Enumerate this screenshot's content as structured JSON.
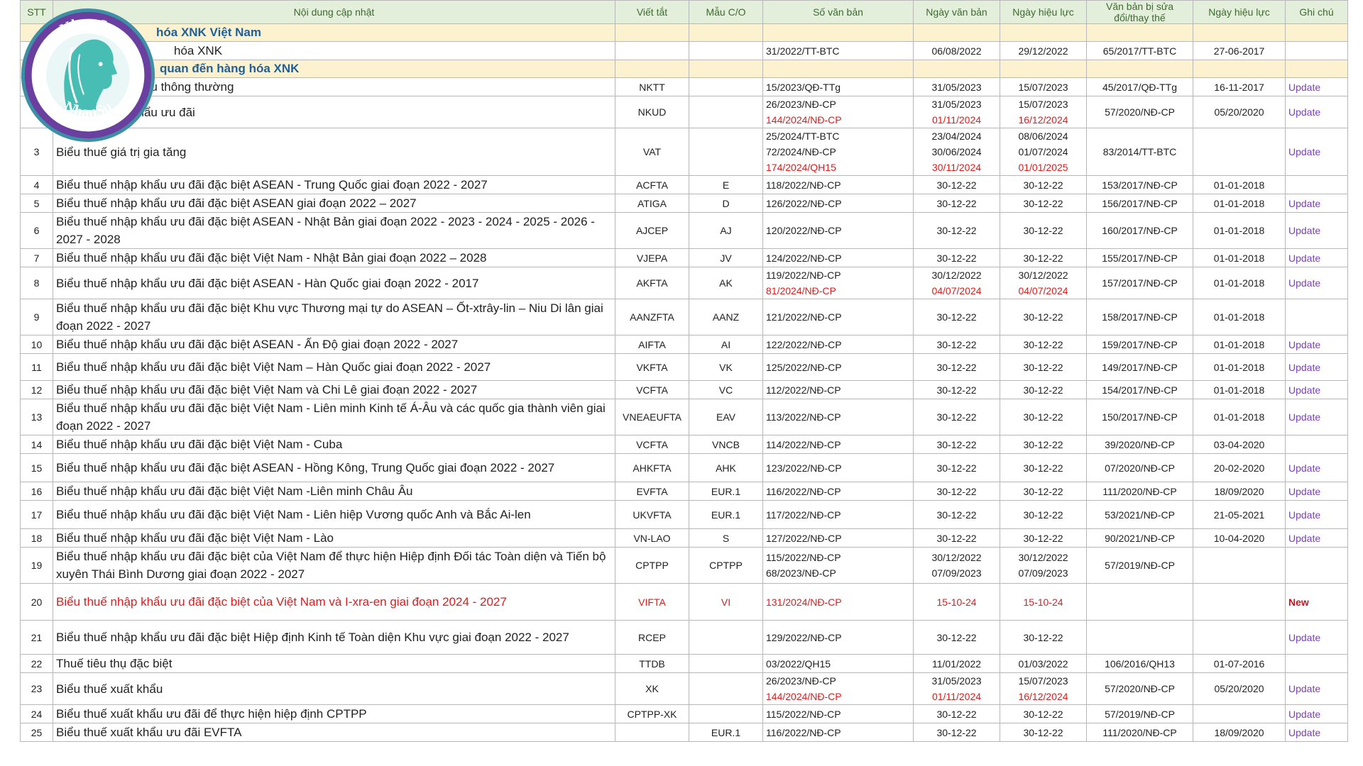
{
  "table": {
    "headers": [
      "STT",
      "Nội dung cập nhật",
      "Viết tắt",
      "Mẫu C/O",
      "Số văn bản",
      "Ngày văn bản",
      "Ngày hiệu lực",
      "Văn bản bị sửa đổi/thay thế",
      "Ngày hiệu lực",
      "Ghi chú"
    ],
    "sections": [
      {
        "title": "hóa XNK Việt Nam"
      },
      {
        "content": "hóa XNK",
        "sovanban": "31/2022/TT-BTC",
        "ngayvb": "06/08/2022",
        "ngayhl": "29/12/2022",
        "vbthaythe": "65/2017/TT-BTC",
        "ngayhl2": "27-06-2017"
      },
      {
        "title": "quan đến hàng hóa XNK"
      }
    ],
    "rows": [
      {
        "stt": "",
        "content": "khẩu thông thường",
        "viettat": "NKTT",
        "mauco": "",
        "sovanban": [
          {
            "t": "15/2023/QĐ-TTg"
          }
        ],
        "ngayvb": [
          {
            "t": "31/05/2023"
          }
        ],
        "ngayhl": [
          {
            "t": "15/07/2023"
          }
        ],
        "vbthaythe": "45/2017/QĐ-TTg",
        "ngayhl2": "16-11-2017",
        "note": "Update",
        "h": 24
      },
      {
        "stt": "",
        "content": "khẩu ưu đãi",
        "viettat": "NKUD",
        "mauco": "",
        "sovanban": [
          {
            "t": "26/2023/NĐ-CP"
          },
          {
            "t": "144/2024/NĐ-CP",
            "red": true
          }
        ],
        "ngayvb": [
          {
            "t": "31/05/2023"
          },
          {
            "t": "01/11/2024",
            "red": true
          }
        ],
        "ngayhl": [
          {
            "t": "15/07/2023"
          },
          {
            "t": "16/12/2024",
            "red": true
          }
        ],
        "vbthaythe": "57/2020/NĐ-CP",
        "ngayhl2": "05/20/2020",
        "note": "Update",
        "h": 40
      },
      {
        "stt": "3",
        "content": "Biểu thuế giá trị gia tăng",
        "viettat": "VAT",
        "mauco": "",
        "sovanban": [
          {
            "t": "25/2024/TT-BTC"
          },
          {
            "t": "72/2024/NĐ-CP"
          },
          {
            "t": "174/2024/QH15",
            "red": true
          }
        ],
        "ngayvb": [
          {
            "t": "23/04/2024"
          },
          {
            "t": "30/06/2024"
          },
          {
            "t": "30/11/2024",
            "red": true
          }
        ],
        "ngayhl": [
          {
            "t": "08/06/2024"
          },
          {
            "t": "01/07/2024"
          },
          {
            "t": "01/01/2025",
            "red": true
          }
        ],
        "vbthaythe": "83/2014/TT-BTC",
        "ngayhl2": "",
        "note": "Update",
        "h": 62
      },
      {
        "stt": "4",
        "content": "Biểu thuế nhập khẩu ưu đãi đặc biệt ASEAN - Trung Quốc giai đoạn 2022 - 2027",
        "viettat": "ACFTA",
        "mauco": "E",
        "sovanban": [
          {
            "t": "118/2022/NĐ-CP"
          }
        ],
        "ngayvb": [
          {
            "t": "30-12-22"
          }
        ],
        "ngayhl": [
          {
            "t": "30-12-22"
          }
        ],
        "vbthaythe": "153/2017/NĐ-CP",
        "ngayhl2": "01-01-2018",
        "note": "",
        "h": 22
      },
      {
        "stt": "5",
        "content": "Biểu thuế nhập khẩu ưu đãi đặc biệt ASEAN giai đoạn 2022 – 2027",
        "viettat": "ATIGA",
        "mauco": "D",
        "sovanban": [
          {
            "t": "126/2022/NĐ-CP"
          }
        ],
        "ngayvb": [
          {
            "t": "30-12-22"
          }
        ],
        "ngayhl": [
          {
            "t": "30-12-22"
          }
        ],
        "vbthaythe": "156/2017/NĐ-CP",
        "ngayhl2": "01-01-2018",
        "note": "Update",
        "h": 22
      },
      {
        "stt": "6",
        "content": "Biểu thuế nhập khẩu ưu đãi đặc biệt ASEAN - Nhật Bản giai đoạn 2022 - 2023 - 2024 - 2025 - 2026 - 2027 - 2028",
        "viettat": "AJCEP",
        "mauco": "AJ",
        "sovanban": [
          {
            "t": "120/2022/NĐ-CP"
          }
        ],
        "ngayvb": [
          {
            "t": "30-12-22"
          }
        ],
        "ngayhl": [
          {
            "t": "30-12-22"
          }
        ],
        "vbthaythe": "160/2017/NĐ-CP",
        "ngayhl2": "01-01-2018",
        "note": "Update",
        "h": 40
      },
      {
        "stt": "7",
        "content": "Biểu thuế nhập khẩu ưu đãi đặc biệt Việt Nam - Nhật Bản giai đoạn 2022 – 2028",
        "viettat": "VJEPA",
        "mauco": "JV",
        "sovanban": [
          {
            "t": "124/2022/NĐ-CP"
          }
        ],
        "ngayvb": [
          {
            "t": "30-12-22"
          }
        ],
        "ngayhl": [
          {
            "t": "30-12-22"
          }
        ],
        "vbthaythe": "155/2017/NĐ-CP",
        "ngayhl2": "01-01-2018",
        "note": "Update",
        "h": 22
      },
      {
        "stt": "8",
        "content": "Biểu thuế nhập khẩu ưu đãi đặc biệt ASEAN - Hàn Quốc giai đoạn 2022 - 2017",
        "viettat": "AKFTA",
        "mauco": "AK",
        "sovanban": [
          {
            "t": "119/2022/NĐ-CP"
          },
          {
            "t": "81/2024/NĐ-CP",
            "red": true
          }
        ],
        "ngayvb": [
          {
            "t": "30/12/2022"
          },
          {
            "t": "04/07/2024",
            "red": true
          }
        ],
        "ngayhl": [
          {
            "t": "30/12/2022"
          },
          {
            "t": "04/07/2024",
            "red": true
          }
        ],
        "vbthaythe": "157/2017/NĐ-CP",
        "ngayhl2": "01-01-2018",
        "note": "Update",
        "h": 40
      },
      {
        "stt": "9",
        "content": "Biểu thuế nhập khẩu ưu đãi đặc biệt Khu vực Thương mại tự do ASEAN – Ốt-xtrây-lin – Niu Di lân giai đoạn 2022 - 2027",
        "viettat": "AANZFTA",
        "mauco": "AANZ",
        "sovanban": [
          {
            "t": "121/2022/NĐ-CP"
          }
        ],
        "ngayvb": [
          {
            "t": "30-12-22"
          }
        ],
        "ngayhl": [
          {
            "t": "30-12-22"
          }
        ],
        "vbthaythe": "158/2017/NĐ-CP",
        "ngayhl2": "01-01-2018",
        "note": "",
        "h": 48
      },
      {
        "stt": "10",
        "content": "Biểu thuế nhập khẩu ưu đãi đặc biệt ASEAN - Ấn Độ giai đoạn 2022 - 2027",
        "viettat": "AIFTA",
        "mauco": "AI",
        "sovanban": [
          {
            "t": "122/2022/NĐ-CP"
          }
        ],
        "ngayvb": [
          {
            "t": "30-12-22"
          }
        ],
        "ngayhl": [
          {
            "t": "30-12-22"
          }
        ],
        "vbthaythe": "159/2017/NĐ-CP",
        "ngayhl2": "01-01-2018",
        "note": "Update",
        "h": 22
      },
      {
        "stt": "11",
        "content": "Biểu thuế nhập khẩu ưu đãi đặc biệt Việt Nam – Hàn Quốc giai đoạn 2022 - 2027",
        "viettat": "VKFTA",
        "mauco": "VK",
        "sovanban": [
          {
            "t": "125/2022/NĐ-CP"
          }
        ],
        "ngayvb": [
          {
            "t": "30-12-22"
          }
        ],
        "ngayhl": [
          {
            "t": "30-12-22"
          }
        ],
        "vbthaythe": "149/2017/NĐ-CP",
        "ngayhl2": "01-01-2018",
        "note": "Update",
        "h": 38
      },
      {
        "stt": "12",
        "content": "Biểu thuế nhập khẩu ưu đãi đặc biệt Việt Nam và Chi Lê giai đoạn 2022 - 2027",
        "viettat": "VCFTA",
        "mauco": "VC",
        "sovanban": [
          {
            "t": "112/2022/NĐ-CP"
          }
        ],
        "ngayvb": [
          {
            "t": "30-12-22"
          }
        ],
        "ngayhl": [
          {
            "t": "30-12-22"
          }
        ],
        "vbthaythe": "154/2017/NĐ-CP",
        "ngayhl2": "01-01-2018",
        "note": "Update",
        "h": 22
      },
      {
        "stt": "13",
        "content": "Biểu thuế nhập khẩu ưu đãi đặc biệt Việt Nam - Liên minh Kinh tế Á-Âu và các quốc gia thành viên giai đoạn 2022 - 2027",
        "viettat": "VNEAEUFTA",
        "mauco": "EAV",
        "sovanban": [
          {
            "t": "113/2022/NĐ-CP"
          }
        ],
        "ngayvb": [
          {
            "t": "30-12-22"
          }
        ],
        "ngayhl": [
          {
            "t": "30-12-22"
          }
        ],
        "vbthaythe": "150/2017/NĐ-CP",
        "ngayhl2": "01-01-2018",
        "note": "Update",
        "h": 48
      },
      {
        "stt": "14",
        "content": "Biểu thuế nhập khẩu ưu đãi đặc biệt Việt Nam - Cuba",
        "viettat": "VCFTA",
        "mauco": "VNCB",
        "sovanban": [
          {
            "t": "114/2022/NĐ-CP"
          }
        ],
        "ngayvb": [
          {
            "t": "30-12-22"
          }
        ],
        "ngayhl": [
          {
            "t": "30-12-22"
          }
        ],
        "vbthaythe": "39/2020/NĐ-CP",
        "ngayhl2": "03-04-2020",
        "note": "",
        "h": 22
      },
      {
        "stt": "15",
        "content": "Biểu thuế nhập khẩu ưu đãi đặc biệt ASEAN - Hồng Kông, Trung Quốc giai đoạn 2022 - 2027",
        "viettat": "AHKFTA",
        "mauco": "AHK",
        "sovanban": [
          {
            "t": "123/2022/NĐ-CP"
          }
        ],
        "ngayvb": [
          {
            "t": "30-12-22"
          }
        ],
        "ngayhl": [
          {
            "t": "30-12-22"
          }
        ],
        "vbthaythe": "07/2020/NĐ-CP",
        "ngayhl2": "20-02-2020",
        "note": "Update",
        "h": 40
      },
      {
        "stt": "16",
        "content": "Biểu thuế nhập khẩu ưu đãi đặc biệt Việt Nam -Liên minh Châu Âu",
        "viettat": "EVFTA",
        "mauco": "EUR.1",
        "sovanban": [
          {
            "t": "116/2022/NĐ-CP"
          }
        ],
        "ngayvb": [
          {
            "t": "30-12-22"
          }
        ],
        "ngayhl": [
          {
            "t": "30-12-22"
          }
        ],
        "vbthaythe": "111/2020/NĐ-CP",
        "ngayhl2": "18/09/2020",
        "note": "Update",
        "h": 22
      },
      {
        "stt": "17",
        "content": "Biểu thuế nhập khẩu ưu đãi đặc biệt Việt Nam - Liên hiệp Vương quốc Anh và Bắc Ai-len",
        "viettat": "UKVFTA",
        "mauco": "EUR.1",
        "sovanban": [
          {
            "t": "117/2022/NĐ-CP"
          }
        ],
        "ngayvb": [
          {
            "t": "30-12-22"
          }
        ],
        "ngayhl": [
          {
            "t": "30-12-22"
          }
        ],
        "vbthaythe": "53/2021/NĐ-CP",
        "ngayhl2": "21-05-2021",
        "note": "Update",
        "h": 40
      },
      {
        "stt": "18",
        "content": "Biểu thuế nhập khẩu ưu đãi đặc biệt Việt Nam - Lào",
        "viettat": "VN-LAO",
        "mauco": "S",
        "sovanban": [
          {
            "t": "127/2022/NĐ-CP"
          }
        ],
        "ngayvb": [
          {
            "t": "30-12-22"
          }
        ],
        "ngayhl": [
          {
            "t": "30-12-22"
          }
        ],
        "vbthaythe": "90/2021/NĐ-CP",
        "ngayhl2": "10-04-2020",
        "note": "Update",
        "h": 22
      },
      {
        "stt": "19",
        "content": "Biểu thuế nhập khẩu ưu đãi đặc biệt của Việt Nam để thực hiện Hiệp định Đối tác Toàn diện và Tiến bộ xuyên Thái Bình Dương giai đoạn 2022 - 2027",
        "viettat": "CPTPP",
        "mauco": "CPTPP",
        "sovanban": [
          {
            "t": "115/2022/NĐ-CP"
          },
          {
            "t": "68/2023/NĐ-CP"
          }
        ],
        "ngayvb": [
          {
            "t": "30/12/2022"
          },
          {
            "t": "07/09/2023"
          }
        ],
        "ngayhl": [
          {
            "t": "30/12/2022"
          },
          {
            "t": "07/09/2023"
          }
        ],
        "vbthaythe": "57/2019/NĐ-CP",
        "ngayhl2": "",
        "note": "",
        "h": 50
      },
      {
        "stt": "20",
        "content": "Biểu thuế nhập khẩu ưu đãi đặc biệt của Việt Nam và I-xra-en giai đoạn 2024 - 2027",
        "viettat": "VIFTA",
        "mauco": "VI",
        "sovanban": [
          {
            "t": "131/2024/NĐ-CP",
            "red": true
          }
        ],
        "ngayvb": [
          {
            "t": "15-10-24",
            "red": true
          }
        ],
        "ngayhl": [
          {
            "t": "15-10-24",
            "red": true
          }
        ],
        "vbthaythe": "",
        "ngayhl2": "",
        "note": "New",
        "newrow": true,
        "h": 52
      },
      {
        "stt": "21",
        "content": "Biểu thuế nhập khẩu ưu đãi đặc biệt Hiệp định Kinh tế Toàn diện Khu vực giai đoạn 2022 - 2027",
        "viettat": "RCEP",
        "mauco": "",
        "sovanban": [
          {
            "t": "129/2022/NĐ-CP"
          }
        ],
        "ngayvb": [
          {
            "t": "30-12-22"
          }
        ],
        "ngayhl": [
          {
            "t": "30-12-22"
          }
        ],
        "vbthaythe": "",
        "ngayhl2": "",
        "note": "Update",
        "h": 48
      },
      {
        "stt": "22",
        "content": "Thuế tiêu thụ đặc biệt",
        "viettat": "TTDB",
        "mauco": "",
        "sovanban": [
          {
            "t": "03/2022/QH15"
          }
        ],
        "ngayvb": [
          {
            "t": "11/01/2022"
          }
        ],
        "ngayhl": [
          {
            "t": "01/03/2022"
          }
        ],
        "vbthaythe": "106/2016/QH13",
        "ngayhl2": "01-07-2016",
        "note": "",
        "h": 22
      },
      {
        "stt": "23",
        "content": "Biểu thuế xuất khẩu",
        "viettat": "XK",
        "mauco": "",
        "sovanban": [
          {
            "t": "26/2023/NĐ-CP"
          },
          {
            "t": "144/2024/NĐ-CP",
            "red": true
          }
        ],
        "ngayvb": [
          {
            "t": "31/05/2023"
          },
          {
            "t": "01/11/2024",
            "red": true
          }
        ],
        "ngayhl": [
          {
            "t": "15/07/2023"
          },
          {
            "t": "16/12/2024",
            "red": true
          }
        ],
        "vbthaythe": "57/2020/NĐ-CP",
        "ngayhl2": "05/20/2020",
        "note": "Update",
        "h": 40
      },
      {
        "stt": "24",
        "content": "Biểu thuế xuất khẩu ưu đãi để thực hiện hiệp định CPTPP",
        "viettat": "CPTPP-XK",
        "mauco": "",
        "sovanban": [
          {
            "t": "115/2022/NĐ-CP"
          }
        ],
        "ngayvb": [
          {
            "t": "30-12-22"
          }
        ],
        "ngayhl": [
          {
            "t": "30-12-22"
          }
        ],
        "vbthaythe": "57/2019/NĐ-CP",
        "ngayhl2": "",
        "note": "Update",
        "h": 22
      },
      {
        "stt": "25",
        "content": "Biểu thuế xuất khẩu ưu đãi EVFTA",
        "viettat": "",
        "mauco": "EUR.1",
        "sovanban": [
          {
            "t": "116/2022/NĐ-CP"
          }
        ],
        "ngayvb": [
          {
            "t": "30-12-22"
          }
        ],
        "ngayhl": [
          {
            "t": "30-12-22"
          }
        ],
        "vbthaythe": "111/2020/NĐ-CP",
        "ngayhl2": "18/09/2020",
        "note": "Update",
        "h": 22
      }
    ]
  },
  "watermark": {
    "text_top": "NhanSu",
    "text_bottom": "NhanSu",
    "icon": "woman-profile-logo",
    "colors": {
      "ring": "#3d8fa5",
      "accent": "#6a3fa0",
      "face": "#2bb3a8"
    }
  },
  "colors": {
    "header_bg": "#e3efda",
    "section_bg": "#fdf2cf",
    "update": "#7b3fb7",
    "new": "#c4161c",
    "red": "#e01b1b"
  }
}
